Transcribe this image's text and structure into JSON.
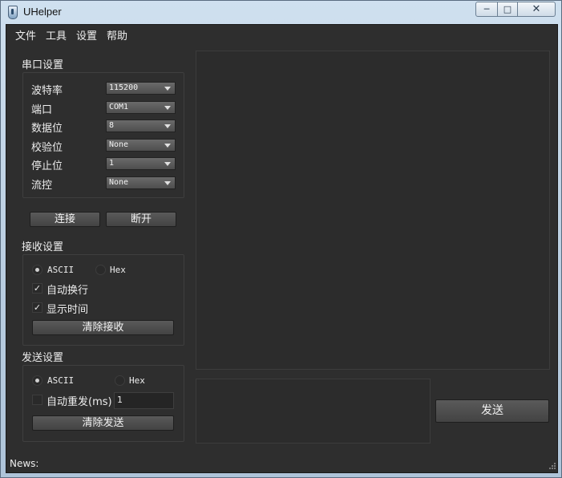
{
  "window": {
    "title": "UHelper",
    "buttons": {
      "minimize": "─",
      "maximize": "□",
      "close": "✕"
    }
  },
  "menu": {
    "items": [
      "文件",
      "工具",
      "设置",
      "帮助"
    ]
  },
  "serial": {
    "title": "串口设置",
    "fields": [
      {
        "label": "波特率",
        "value": "115200"
      },
      {
        "label": "端口",
        "value": "COM1"
      },
      {
        "label": "数据位",
        "value": "8"
      },
      {
        "label": "校验位",
        "value": "None"
      },
      {
        "label": "停止位",
        "value": "1"
      },
      {
        "label": "流控",
        "value": "None"
      }
    ],
    "connect_label": "连接",
    "disconnect_label": "断开"
  },
  "receive": {
    "title": "接收设置",
    "mode_ascii": "ASCII",
    "mode_hex": "Hex",
    "auto_wrap": "自动换行",
    "show_time": "显示时间",
    "clear_label": "清除接收"
  },
  "send": {
    "title": "发送设置",
    "mode_ascii": "ASCII",
    "mode_hex": "Hex",
    "auto_resend": "自动重发(ms)",
    "interval": "1",
    "clear_label": "清除发送",
    "send_label": "发送"
  },
  "status": {
    "news_label": "News:"
  },
  "colors": {
    "background": "#2e2e2e",
    "button": "#4e4e4e"
  }
}
